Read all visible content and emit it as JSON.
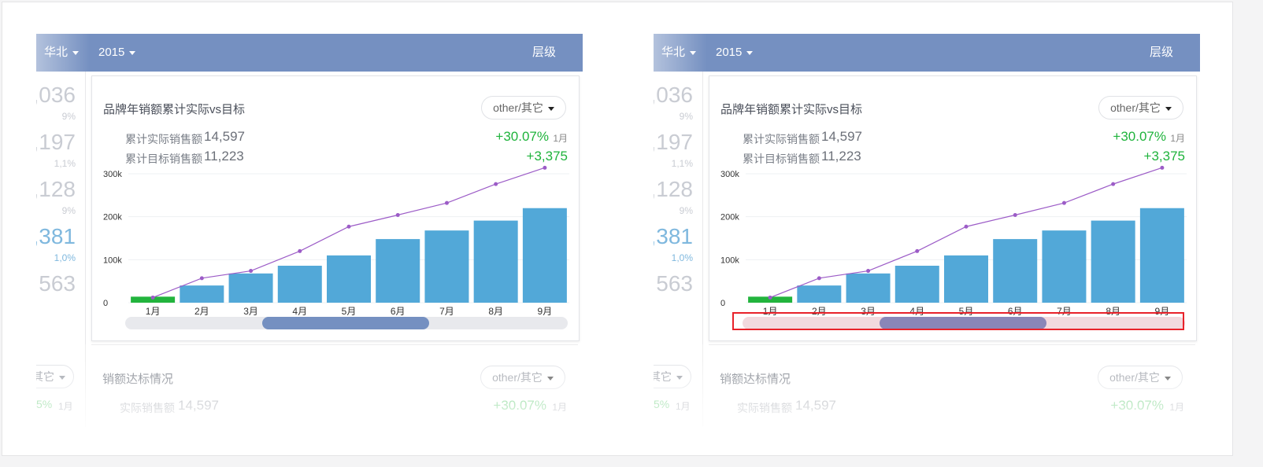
{
  "topbar": {
    "region": "华北",
    "year": "2015",
    "levels": "层级"
  },
  "left_numbers": [
    {
      "big": ",036",
      "small": "9%"
    },
    {
      "big": ",197",
      "small": "1,1%"
    },
    {
      "big": ",128",
      "small": "9%"
    },
    {
      "big": ",381",
      "small": "1,0%"
    },
    {
      "big": "563",
      "small": ""
    }
  ],
  "card": {
    "title": "品牌年销额累计实际vs目标",
    "dropdown": "other/其它",
    "actual_label": "累计实际销售额",
    "actual_value": "14,597",
    "target_label": "累计目标销售额",
    "target_value": "11,223",
    "growth": "+30.07%",
    "month": "1月",
    "diff": "+3,375"
  },
  "chart_data": {
    "type": "bar",
    "categories": [
      "1月",
      "2月",
      "3月",
      "4月",
      "5月",
      "6月",
      "7月",
      "8月",
      "9月"
    ],
    "series": [
      {
        "type": "bar",
        "values": [
          14,
          40,
          68,
          86,
          110,
          148,
          168,
          191,
          220
        ]
      },
      {
        "type": "line",
        "values": [
          12,
          57,
          74,
          120,
          177,
          204,
          232,
          276,
          314
        ]
      }
    ],
    "highlight_first_bar_color": "#22b43d",
    "bar_color": "#52a8d8",
    "line_color": "#9c5cc7",
    "y_ticks": [
      "0",
      "100k",
      "200k",
      "300k"
    ],
    "ylim": [
      0,
      320
    ]
  },
  "card2": {
    "title": "销额达标情况",
    "dropdown": "other/其它",
    "label": "实际销售额",
    "value": "14,597",
    "growth": "+30.07%",
    "month": "1月",
    "left_dropdown": "其它",
    "left_pct": "5%",
    "left_month": "1月"
  },
  "colors": {
    "topbar": "#7590c1",
    "scroll_thumb": "#7590c1",
    "highlight": "#e8222a"
  }
}
